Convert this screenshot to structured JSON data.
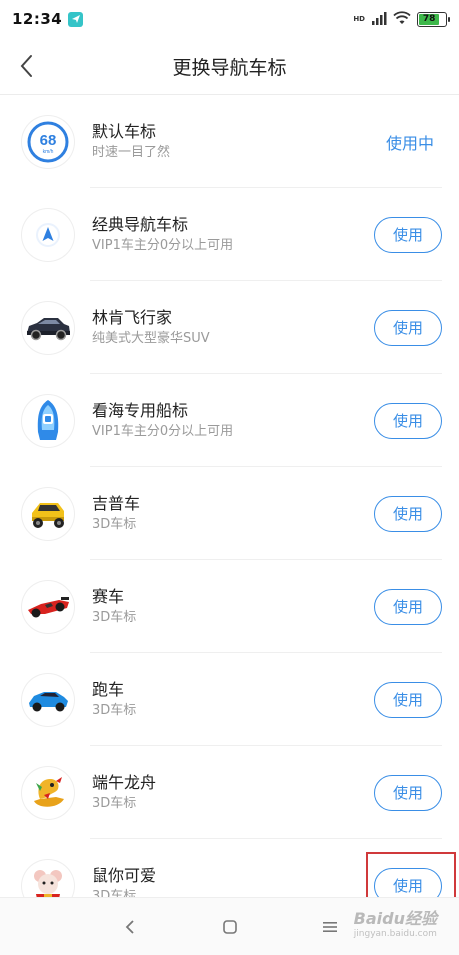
{
  "status_bar": {
    "time": "12:34",
    "battery": "78",
    "network": "HD"
  },
  "header": {
    "title": "更换导航车标"
  },
  "items": [
    {
      "title": "默认车标",
      "subtitle": "时速一目了然",
      "action": "使用中",
      "in_use": true,
      "icon": "speedometer-icon",
      "speed": "68",
      "unit": "km/h"
    },
    {
      "title": "经典导航车标",
      "subtitle": "VIP1车主分0分以上可用",
      "action": "使用",
      "icon": "nav-arrow-icon"
    },
    {
      "title": "林肯飞行家",
      "subtitle": "纯美式大型豪华SUV",
      "action": "使用",
      "icon": "suv-icon"
    },
    {
      "title": "看海专用船标",
      "subtitle": "VIP1车主分0分以上可用",
      "action": "使用",
      "icon": "boat-icon"
    },
    {
      "title": "吉普车",
      "subtitle": "3D车标",
      "action": "使用",
      "icon": "jeep-icon"
    },
    {
      "title": "赛车",
      "subtitle": "3D车标",
      "action": "使用",
      "icon": "race-car-icon"
    },
    {
      "title": "跑车",
      "subtitle": "3D车标",
      "action": "使用",
      "icon": "sports-car-icon"
    },
    {
      "title": "端午龙舟",
      "subtitle": "3D车标",
      "action": "使用",
      "icon": "dragon-boat-icon"
    },
    {
      "title": "鼠你可爱",
      "subtitle": "3D车标",
      "action": "使用",
      "icon": "mouse-icon"
    }
  ],
  "colors": {
    "accent": "#3a8ee6",
    "highlight": "#d0393b"
  },
  "watermark": {
    "logo": "Baidu经验",
    "sub": "jingyan.baidu.com"
  }
}
